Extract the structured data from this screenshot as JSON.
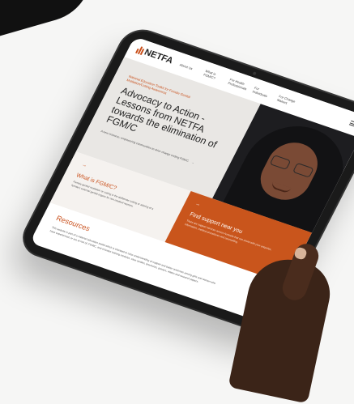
{
  "brand": {
    "logo": "NETFA",
    "accent": "#c94f1a"
  },
  "nav": {
    "items": [
      "About Us",
      "What is FGM/C?",
      "For Health Professionals",
      "For Individuals",
      "For Change Makers"
    ]
  },
  "hero": {
    "eyebrow": "National Education Toolkit for Female Genital Mutilation/Cutting Awareness",
    "title": "Advocacy to Action - Lessons from NETFA towards the elimination of FGM/C",
    "sub": "A new resource: empowering communities to drive change ending FGM/C"
  },
  "what": {
    "title": "What is FGM/C?",
    "text": "Female genital mutilation or cutting is the deliberate cutting or altering of a female's external genital organs for non-medical reasons."
  },
  "support": {
    "title": "Find support near you",
    "text": "There are support services across Australia that can assist with your enquiries, information, medical procedures and counselling."
  },
  "resources": {
    "title": "Resources",
    "text": "This website is part of a national education toolkit which is intended to raise understanding of support and better outcomes among girls and women who have experienced, or are at risk of, FGM/C, and includes training modules, case studies, brochures, posters, videos and research papers."
  }
}
